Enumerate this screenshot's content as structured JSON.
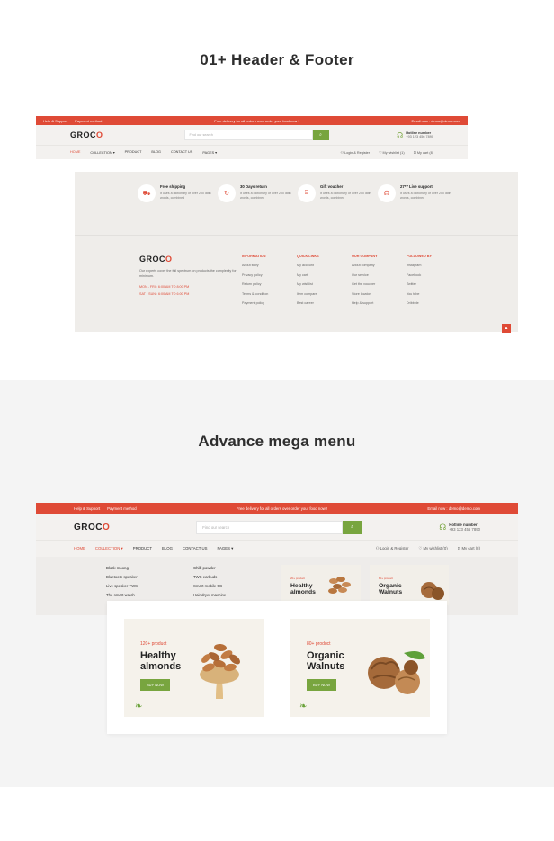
{
  "headings": {
    "header_footer": "01+ Header & Footer",
    "mega_menu": "Advance mega menu"
  },
  "colors": {
    "accent": "#df4a36",
    "green": "#78a53f"
  },
  "header": {
    "top_left": [
      "Help & Support",
      "Payment method"
    ],
    "free_delivery": "Free delivery for all orders over order your food now !",
    "email_a": "Email now : demo@demo.com",
    "email_b": "Email now : demo@demo.com",
    "logo": [
      "GROC",
      "O"
    ],
    "search_placeholder": "Find our search",
    "hotline_title": "Hotline number",
    "hotline_number": "+93 123 456 7890",
    "nav": [
      "HOME",
      "COLLECTION ▾",
      "PRODUCT",
      "BLOG",
      "CONTACT US",
      "PAGES ▾"
    ],
    "actions": [
      "Login & Register",
      "My wishlist (1)",
      "My cart (8)"
    ],
    "actions_b": [
      "Login & Register",
      "My wishlist (0)",
      "My cart (8)"
    ]
  },
  "footer": {
    "features": [
      {
        "icon": "truck-icon",
        "title": "Free shipping",
        "desc": "It uses a dictionary of over 200 latin words, combined"
      },
      {
        "icon": "return-icon",
        "title": "30 Days return",
        "desc": "It uses a dictionary of over 200 latin words, combined"
      },
      {
        "icon": "gift-icon",
        "title": "Gift voucher",
        "desc": "It uses a dictionary of over 200 latin words, combined"
      },
      {
        "icon": "headset-icon",
        "title": "27*7 Live support",
        "desc": "It uses a dictionary of over 200 latin words, combined"
      }
    ],
    "about": "Our experts cover the full spectrum on products the complexity for minimum.",
    "hours": [
      "MON - FRI : 6:00 AM TO 8:00 PM",
      "SAT - SUN : 6:00 AM TO 6:00 PM"
    ],
    "columns": [
      {
        "title": "INFORMATION",
        "items": [
          "About story",
          "Privacy policy",
          "Return policy",
          "Terms & condition",
          "Payment policy"
        ]
      },
      {
        "title": "QUICK LINKS",
        "items": [
          "My account",
          "My cart",
          "My wishlist",
          "Item compare",
          "Best career"
        ]
      },
      {
        "title": "OUR COMPANY",
        "items": [
          "About company",
          "Our service",
          "Get the voucher",
          "Store locator",
          "Help & support"
        ]
      },
      {
        "title": "FOLLOWED BY",
        "items": [
          "Instagram",
          "Facebook",
          "Twitter",
          "You tube",
          "Dribbble"
        ]
      }
    ],
    "to_top": "▲"
  },
  "mega": {
    "col1": [
      "Block moong",
      "Bluetooth speaker",
      "Live speaker TWS",
      "The smart watch"
    ],
    "col2": [
      "Chilli powder",
      "TWS earbuds",
      "Smart mobile 5G",
      "Hair dryer machine"
    ],
    "banner1": {
      "tag": "120+ product",
      "title_1": "Healthy",
      "title_2": "almonds",
      "button": "BUY NOW"
    },
    "banner2": {
      "tag": "80+ product",
      "title_1": "Organic",
      "title_2": "Walnuts",
      "button": "BUY NOW"
    },
    "mini1": {
      "tag": "20+ product",
      "title_1": "Healthy",
      "title_2": "almonds"
    },
    "mini2": {
      "tag": "80+ product",
      "title_1": "Organic",
      "title_2": "Walnuts"
    }
  }
}
